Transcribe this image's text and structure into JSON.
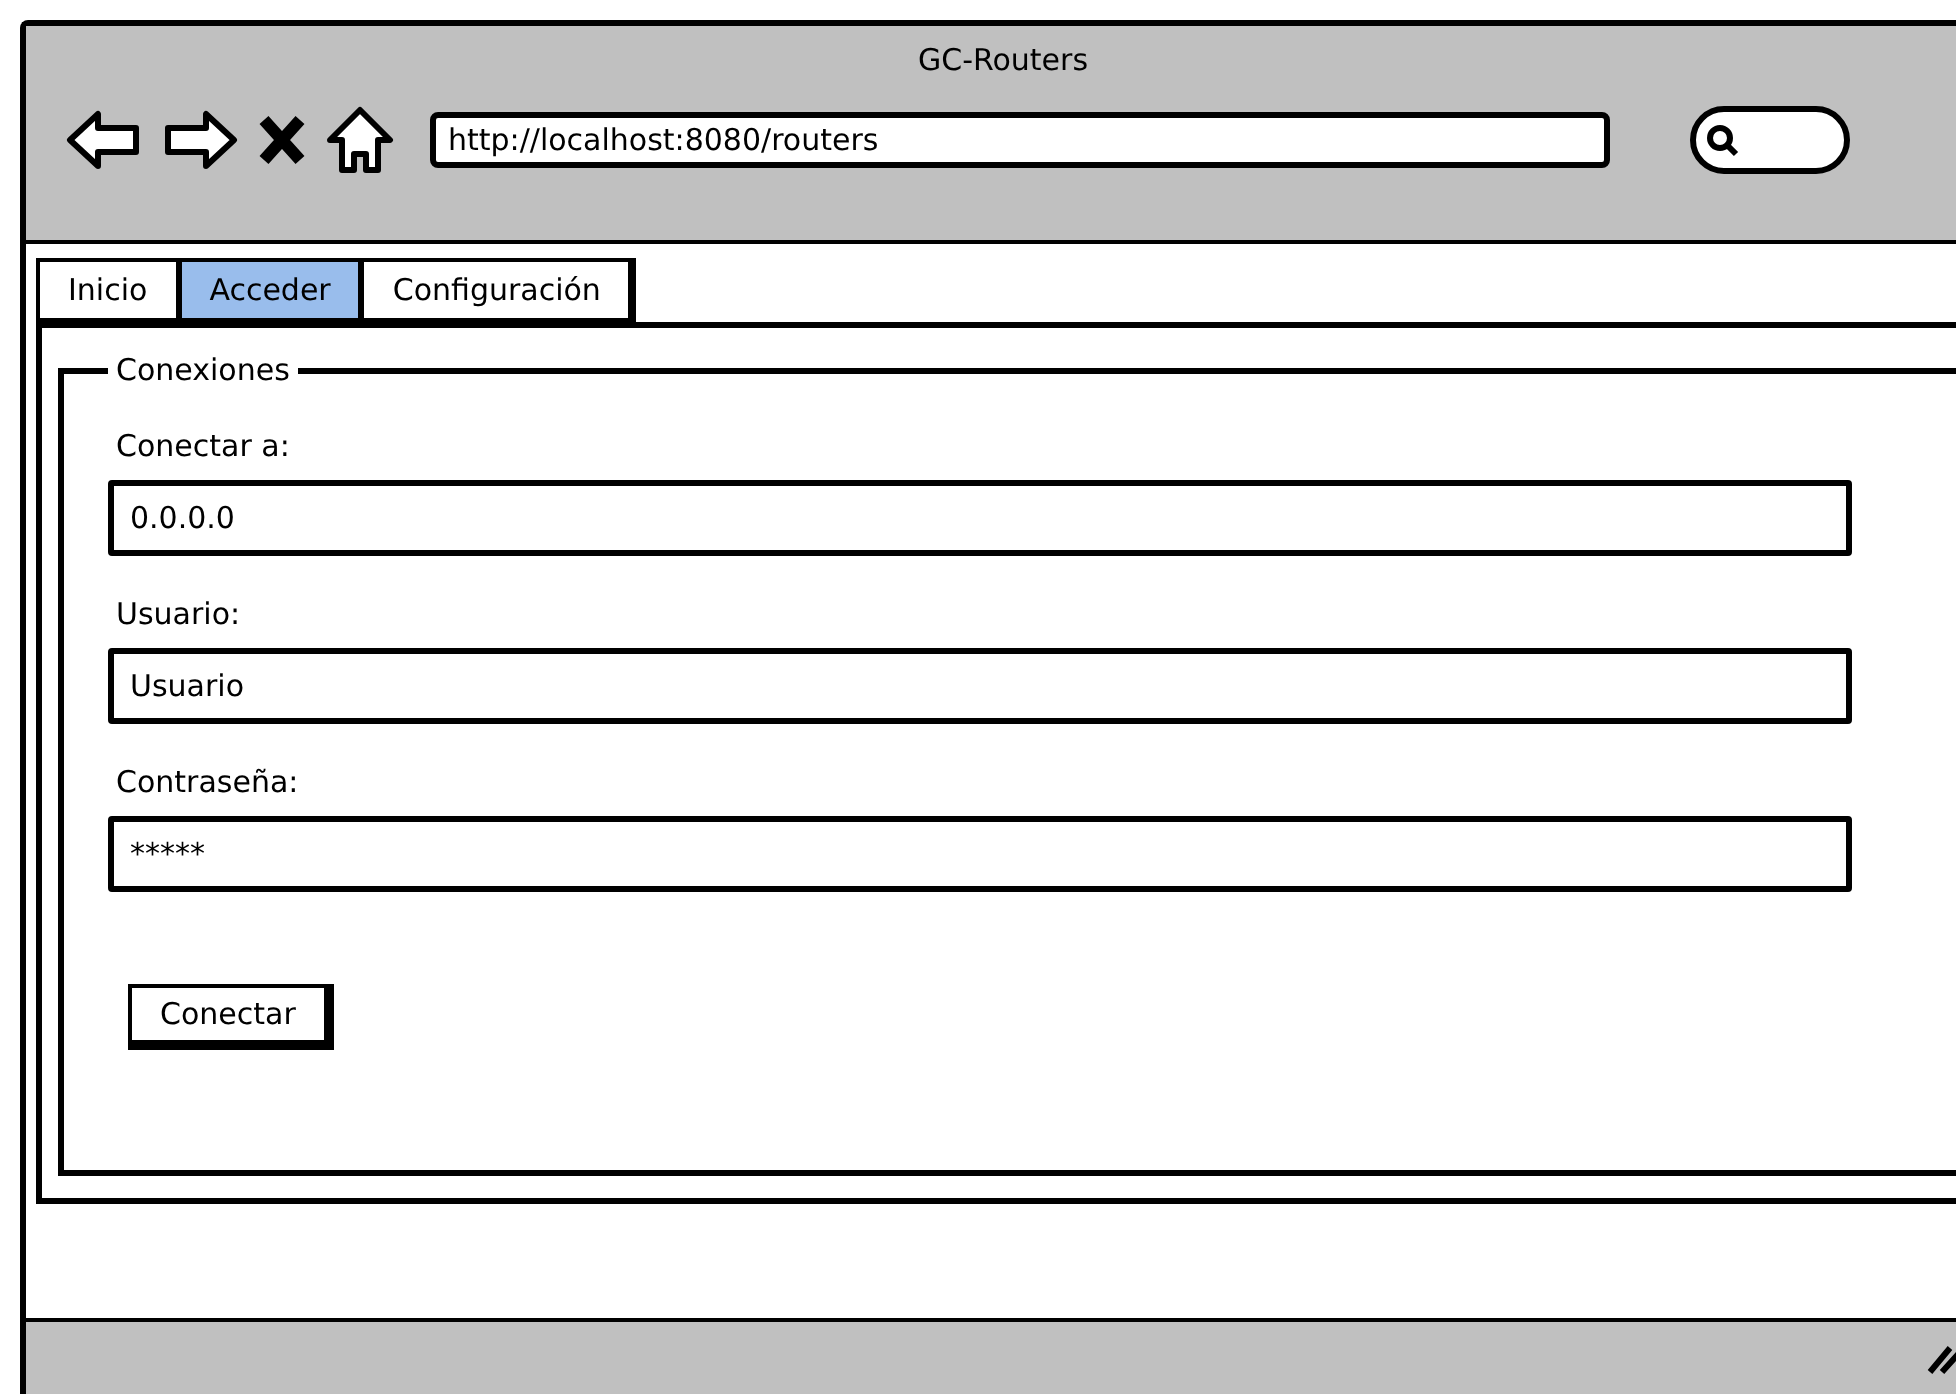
{
  "window": {
    "title": "GC-Routers"
  },
  "browser": {
    "url": "http://localhost:8080/routers"
  },
  "tabs": [
    {
      "label": "Inicio",
      "selected": false
    },
    {
      "label": "Acceder",
      "selected": true
    },
    {
      "label": "Configuración",
      "selected": false
    }
  ],
  "group": {
    "title": "Conexiones",
    "fields": [
      {
        "label": "Conectar a:",
        "value": "0.0.0.0"
      },
      {
        "label": "Usuario:",
        "value": "Usuario"
      },
      {
        "label": "Contraseña:",
        "value": "*****"
      }
    ],
    "button": "Conectar"
  }
}
